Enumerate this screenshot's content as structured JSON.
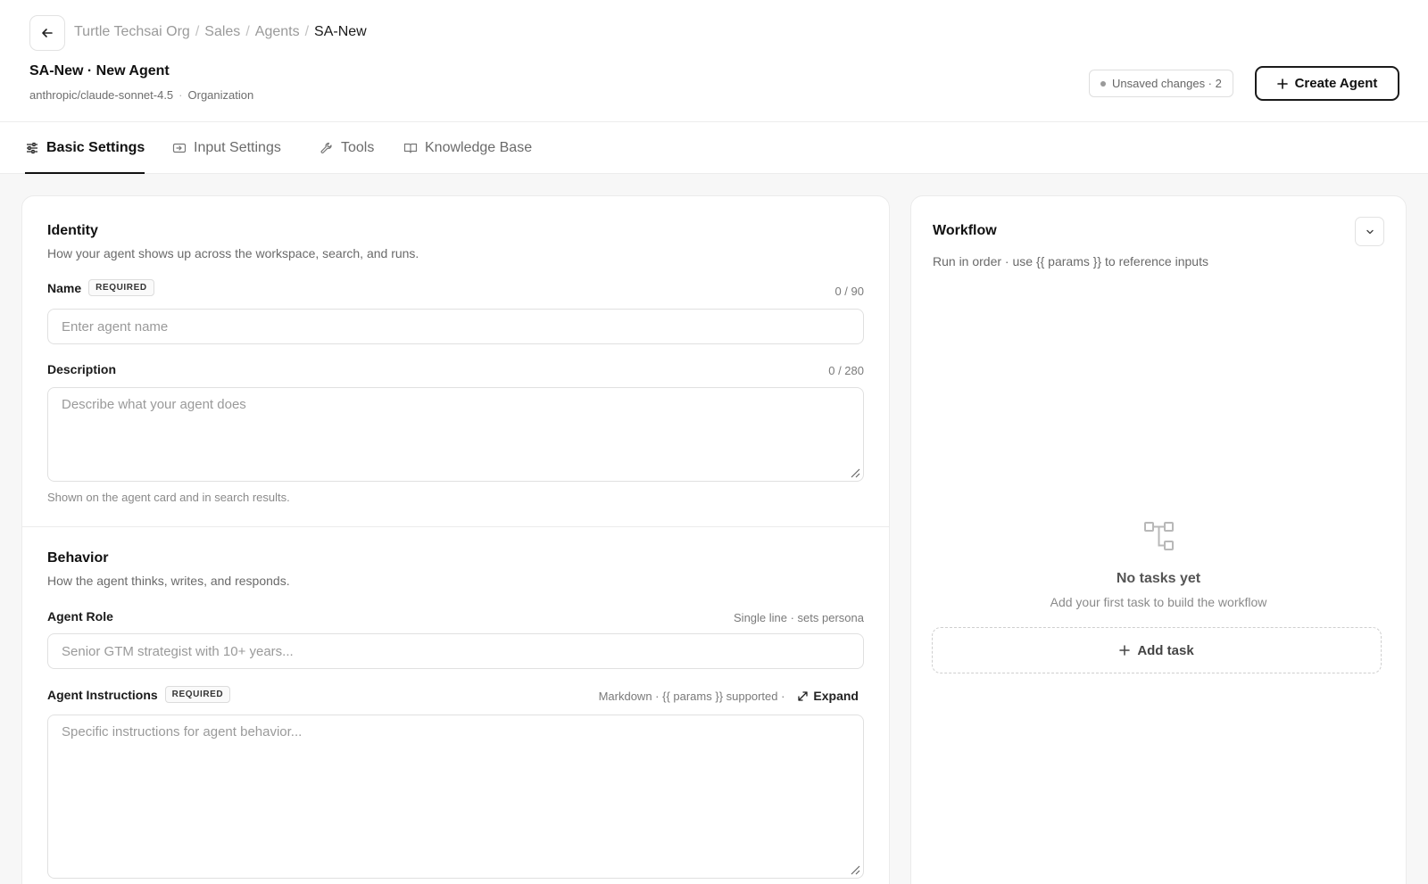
{
  "header": {
    "breadcrumb": [
      "Turtle Techsai Org",
      "Sales",
      "Agents"
    ],
    "breadcrumb_current": "SA-New",
    "title": "SA-New · New Agent",
    "model": "anthropic/claude-sonnet-4.5",
    "scope": "Organization",
    "unsaved_label": "Unsaved changes · 2",
    "create_label": "Create Agent"
  },
  "tabs": [
    {
      "label": "Basic Settings",
      "icon": "sliders-icon",
      "active": true
    },
    {
      "label": "Input Settings",
      "icon": "input-icon",
      "active": false
    },
    {
      "label": "Tools",
      "icon": "wrench-icon",
      "active": false
    },
    {
      "label": "Knowledge Base",
      "icon": "book-icon",
      "active": false
    }
  ],
  "identity": {
    "title": "Identity",
    "description": "How your agent shows up across the workspace, search, and runs.",
    "name": {
      "label": "Name",
      "badge": "REQUIRED",
      "counter": "0 / 90",
      "placeholder": "Enter agent name",
      "value": ""
    },
    "description_field": {
      "label": "Description",
      "counter": "0 / 280",
      "placeholder": "Describe what your agent does",
      "value": "",
      "hint": "Shown on the agent card and in search results."
    }
  },
  "behavior": {
    "title": "Behavior",
    "description": "How the agent thinks, writes, and responds.",
    "role": {
      "label": "Agent Role",
      "meta": "Single line · sets persona",
      "placeholder": "Senior GTM strategist with 10+ years...",
      "value": ""
    },
    "instructions": {
      "label": "Agent Instructions",
      "badge": "REQUIRED",
      "meta": "Markdown · {{ params }} supported ·",
      "expand_label": "Expand",
      "placeholder": "Specific instructions for agent behavior...",
      "value": ""
    }
  },
  "workflow": {
    "title": "Workflow",
    "description": "Run in order · use {{ params }} to reference inputs",
    "empty_title": "No tasks yet",
    "empty_desc": "Add your first task to build the workflow",
    "add_task_label": "Add task"
  },
  "colors": {
    "accent": "#111111",
    "muted_text": "#9a9a9a",
    "border": "#e0e0e0",
    "background": "#f7f7f7"
  }
}
